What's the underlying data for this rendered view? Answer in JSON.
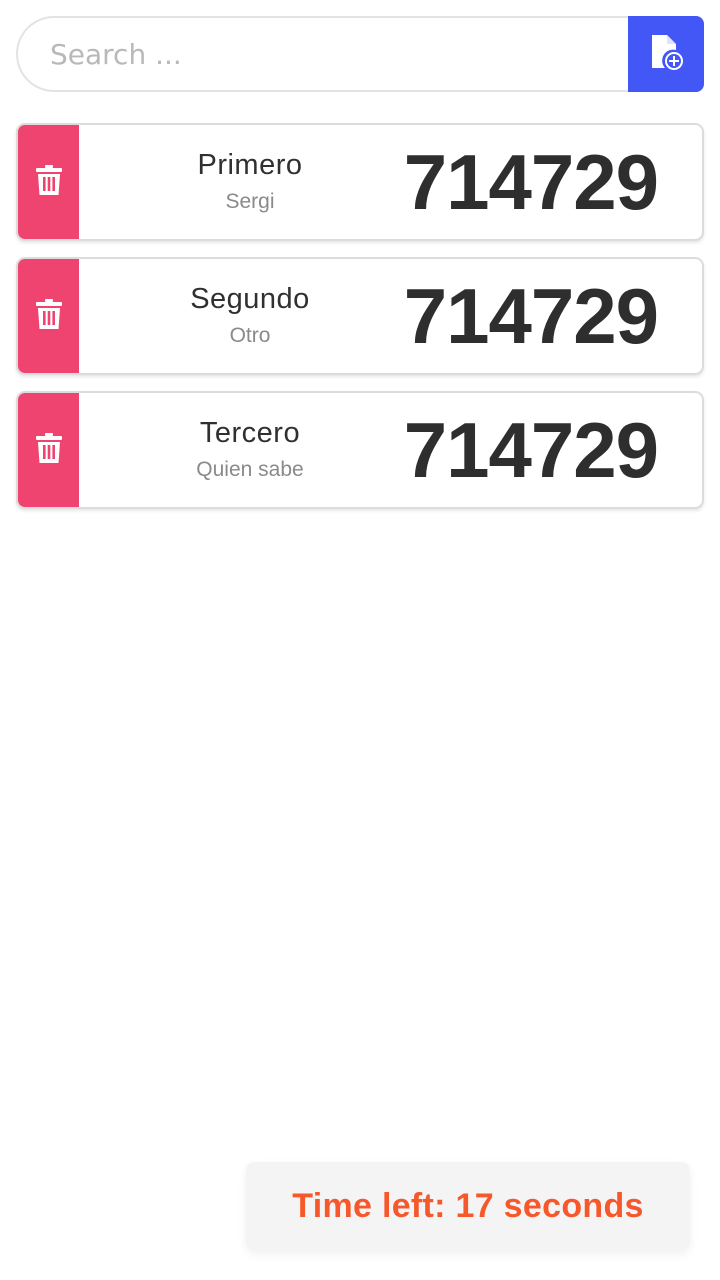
{
  "search": {
    "placeholder": "Search ..."
  },
  "add_button": {
    "icon": "file-add-icon",
    "color": "#4257f5"
  },
  "entries": [
    {
      "title": "Primero",
      "subtitle": "Sergi",
      "code": "714729"
    },
    {
      "title": "Segundo",
      "subtitle": "Otro",
      "code": "714729"
    },
    {
      "title": "Tercero",
      "subtitle": "Quien sabe",
      "code": "714729"
    }
  ],
  "delete_button": {
    "icon": "trash-icon",
    "color": "#f04470"
  },
  "timer": {
    "text": "Time left: 17 seconds",
    "color": "#f6582b"
  }
}
